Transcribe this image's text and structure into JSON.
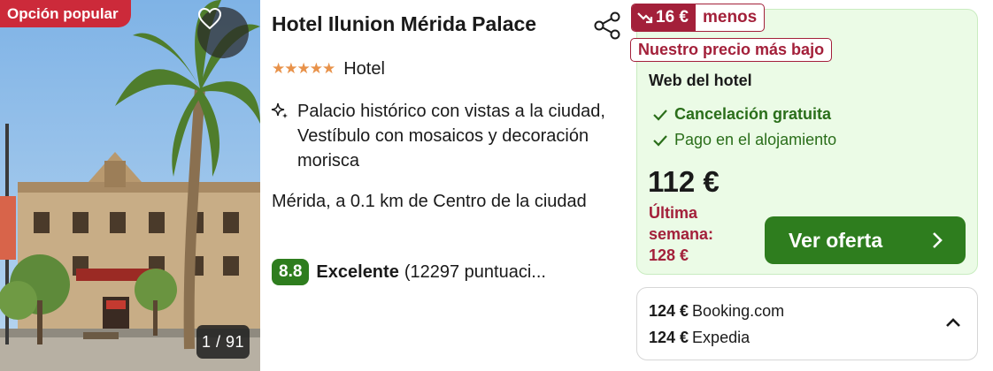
{
  "photo": {
    "badge": "Opción popular",
    "counter": "1 / 91",
    "favorite_icon": "heart-outline-icon"
  },
  "hotel": {
    "name": "Hotel Ilunion Mérida Palace",
    "stars": "★★★★★",
    "star_count": 5,
    "type": "Hotel",
    "highlight": "Palacio histórico con vistas a la ciudad, Vestíbulo con mosaicos y decoración morisca",
    "location": "Mérida, a 0.1 km de Centro de la ciudad",
    "rating_score": "8.8",
    "rating_label": "Excelente",
    "rating_count": "(12297 puntuaci..."
  },
  "deal": {
    "savings_amount": "16 €",
    "savings_word": "menos",
    "lowest_price_tag": "Nuestro precio más bajo",
    "provider": "Web del hotel",
    "features": [
      "Cancelación gratuita",
      "Pago en el alojamiento"
    ],
    "price": "112 €",
    "last_week_label": "Última semana:",
    "last_week_price": "128 €",
    "button_label": "Ver oferta"
  },
  "other_prices": [
    {
      "price": "124 €",
      "site": "Booking.com"
    },
    {
      "price": "124 €",
      "site": "Expedia"
    }
  ],
  "colors": {
    "popular_red": "#cc2a3a",
    "savings_red": "#a3203a",
    "deal_bg": "#ebfbe6",
    "green": "#2e7d1e",
    "star_orange": "#e8924a"
  }
}
